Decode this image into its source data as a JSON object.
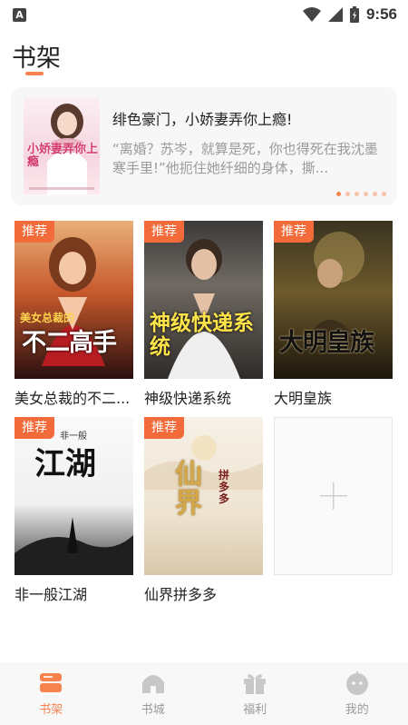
{
  "status_bar": {
    "time": "9:56",
    "app_icon": "A"
  },
  "header": {
    "title": "书架"
  },
  "banner": {
    "title": "绯色豪门，小娇妻弄你上瘾!",
    "description": "“离婚？苏岑，就算是死，你也得死在我沈墨寒手里!”他扼住她纤细的身体，撕...",
    "cover_title": "小娇妻弄你上瘾",
    "dots": 6,
    "active_dot": 0
  },
  "books": [
    {
      "name": "美女总裁的不二...",
      "tag": "推荐",
      "cover_text": "不二高手",
      "cover_sub": "美女总裁的"
    },
    {
      "name": "神级快递系统",
      "tag": "推荐",
      "cover_text": "神级快递系统",
      "cover_sub": ""
    },
    {
      "name": "大明皇族",
      "tag": "推荐",
      "cover_text": "大明皇族",
      "cover_sub": ""
    },
    {
      "name": "非一般江湖",
      "tag": "推荐",
      "cover_text": "江湖",
      "cover_sub": "非一般"
    },
    {
      "name": "仙界拼多多",
      "tag": "推荐",
      "cover_text": "仙界",
      "cover_sub": "拼多多"
    }
  ],
  "add_card": {
    "icon": "plus-icon"
  },
  "nav": {
    "items": [
      {
        "label": "书架",
        "icon": "bookshelf-icon",
        "active": true
      },
      {
        "label": "书城",
        "icon": "bookstore-icon",
        "active": false
      },
      {
        "label": "福利",
        "icon": "gift-icon",
        "active": false
      },
      {
        "label": "我的",
        "icon": "profile-icon",
        "active": false
      }
    ]
  },
  "colors": {
    "accent": "#f7834f",
    "tag": "#f36b3a",
    "nav_inactive": "#c8c8c8"
  }
}
